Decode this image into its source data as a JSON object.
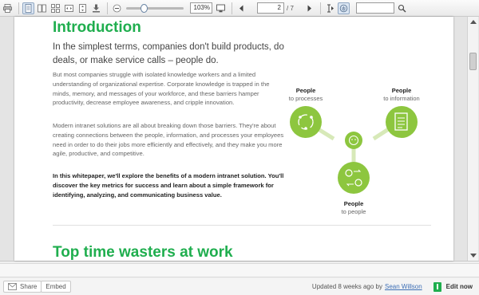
{
  "toolbar": {
    "zoom_value": "103%",
    "page_current": "2",
    "page_total": "/ 7",
    "zoom_level": 0.28
  },
  "document": {
    "intro_title": "Introduction",
    "lead": "In the simplest terms, companies don't build products, do deals, or make service calls – people do.",
    "para1": "But most companies struggle with isolated knowledge workers and a limited understanding of organizational expertise. Corporate knowledge is trapped in the minds, memory, and messages of your workforce, and these barriers hamper productivity, decrease employee awareness, and cripple innovation.",
    "para2": "Modern intranet solutions are all about breaking down those barriers. They're about creating connections between the people, information, and processes your employees need in order to do their jobs more efficiently and effectively, and they make you more agile, productive, and competitive.",
    "para3": "In this whitepaper, we'll explore the benefits of a modern intranet solution. You'll discover the key metrics for success and learn about a simple framework for identifying, analyzing, and communicating business value.",
    "diagram": {
      "processes_bold": "People",
      "processes_rest": "to processes",
      "information_bold": "People",
      "information_rest": "to information",
      "people_bold": "People",
      "people_rest": "to people"
    },
    "section_title": "Top time wasters at work"
  },
  "footer": {
    "share_label": "Share",
    "embed_label": "Embed",
    "updated_text": "Updated 8 weeks ago by",
    "author": "Sean Willson",
    "edit_label": "Edit now"
  },
  "colors": {
    "accent_green": "#1fae4e",
    "link_blue": "#3e6fb5"
  }
}
